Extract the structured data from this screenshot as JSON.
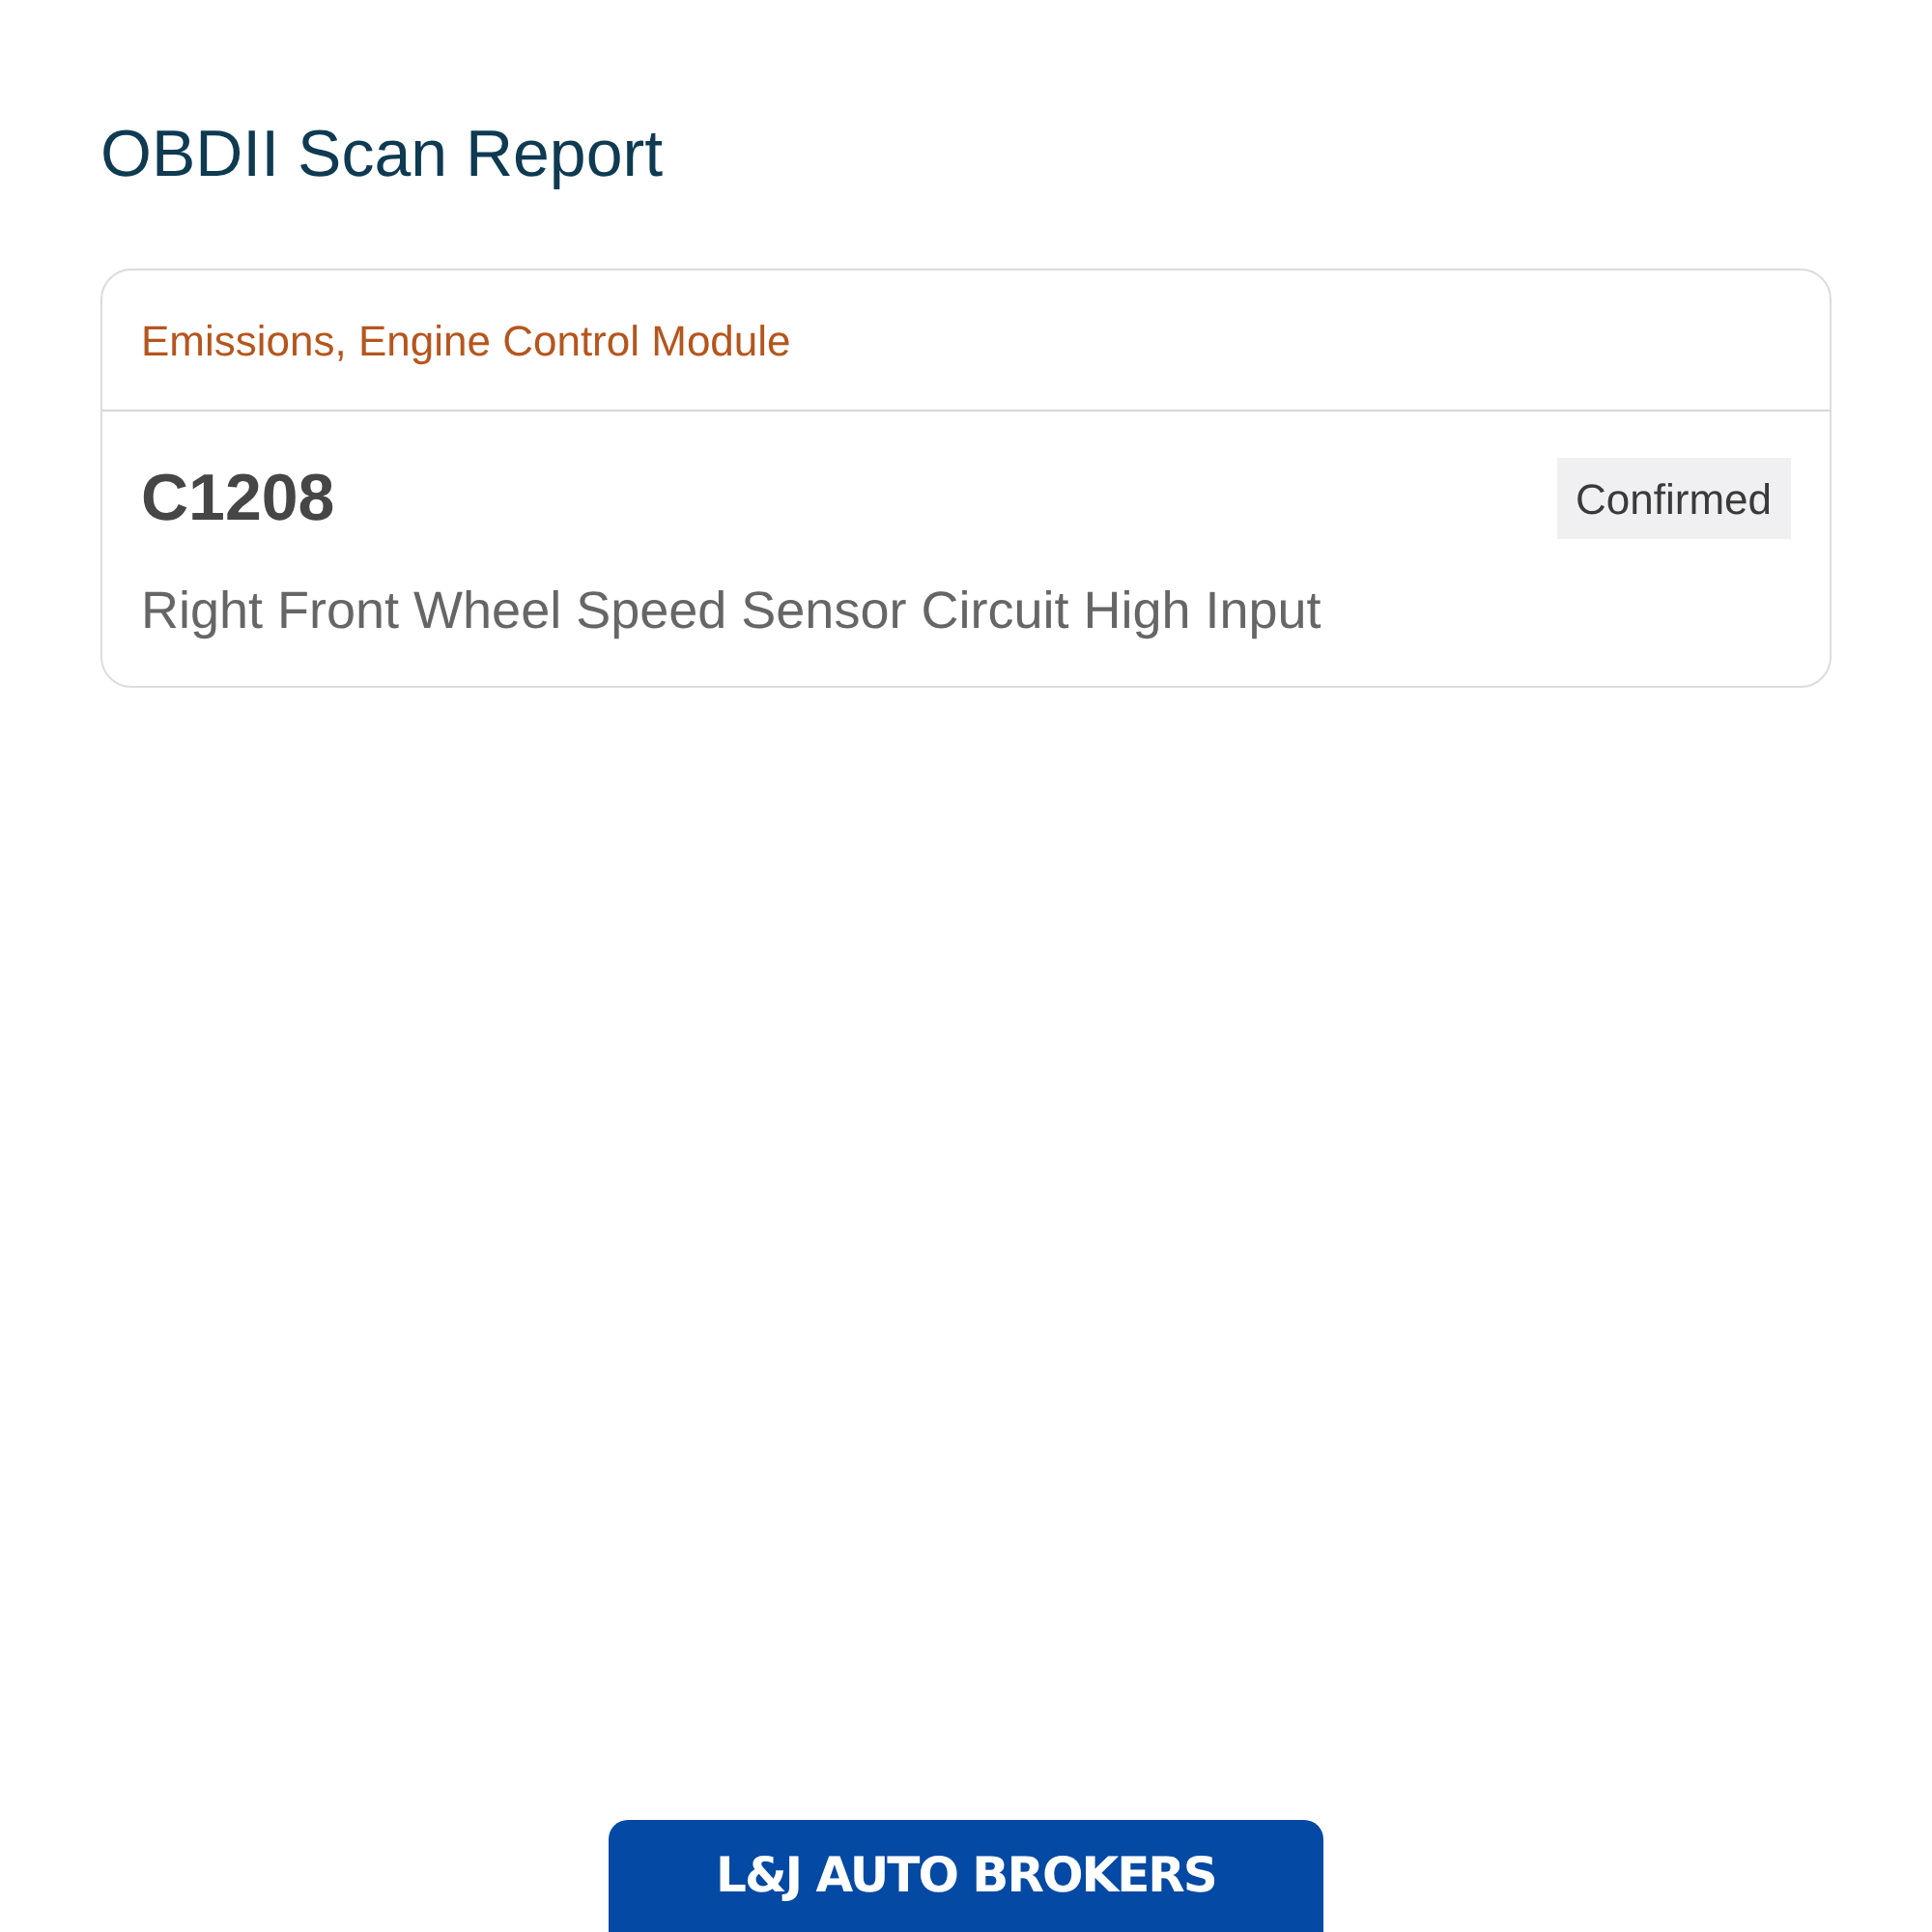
{
  "page": {
    "title": "OBDII Scan Report"
  },
  "codes": [
    {
      "module": "Emissions, Engine Control Module",
      "code": "C1208",
      "status": "Confirmed",
      "description": "Right Front Wheel Speed Sensor Circuit High Input"
    }
  ],
  "footer": {
    "logo_text": "L&J AUTO BROKERS"
  }
}
